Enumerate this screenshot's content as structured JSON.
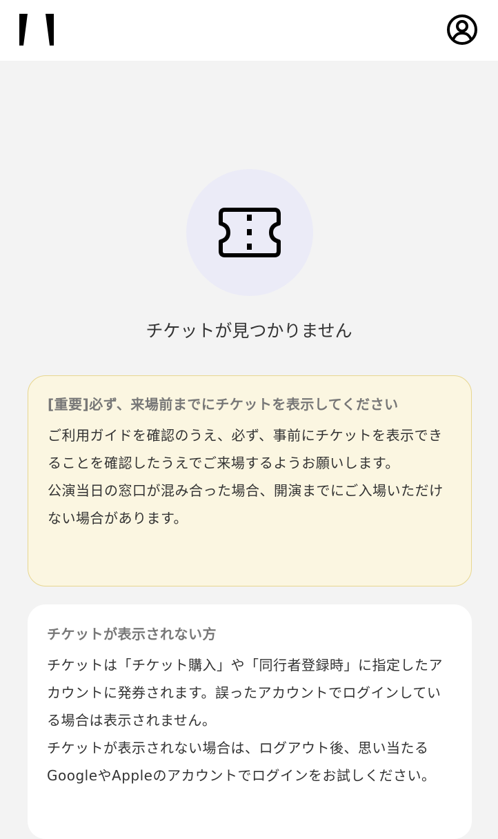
{
  "header": {
    "logo_icon": "brand-logo-icon",
    "account_icon": "account-circle-icon"
  },
  "empty_state": {
    "icon": "ticket-icon",
    "icon_bg_color": "#ebebf7",
    "title": "チケットが見つかりません"
  },
  "notice": {
    "bg_color": "#fbf6e1",
    "border_color": "#e7d68f",
    "title": "[重要]必ず、来場前までにチケットを表示してください",
    "paragraphs": [
      "ご利用ガイドを確認のうえ、必ず、事前にチケットを表示できることを確認したうえでご来場するようお願いします。",
      "公演当日の窓口が混み合った場合、開演までにご入場いただけない場合があります。"
    ]
  },
  "help": {
    "title": "チケットが表示されない方",
    "paragraphs": [
      "チケットは「チケット購入」や「同行者登録時」に指定したアカウントに発券されます。誤ったアカウントでログインしている場合は表示されません。",
      "チケットが表示されない場合は、ログアウト後、思い当たるGoogleやAppleのアカウントでログインをお試しください。"
    ]
  }
}
